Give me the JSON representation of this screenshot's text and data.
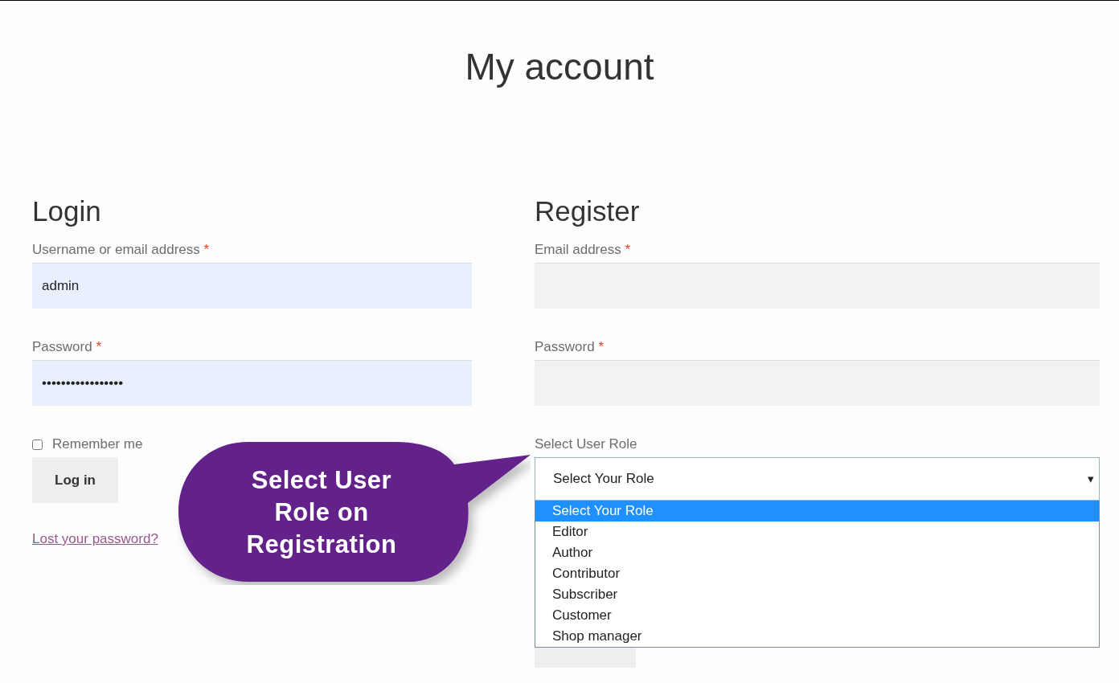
{
  "page_title": "My account",
  "login": {
    "heading": "Login",
    "fields": [
      {
        "label": "Username or email address",
        "required": "*",
        "value": "admin"
      },
      {
        "label": "Password",
        "required": "*",
        "value": "•••••••••••••••••"
      }
    ],
    "remember": {
      "label": "Remember me",
      "checked": false
    },
    "button": "Log in",
    "lost_password": "Lost your password?"
  },
  "register": {
    "heading": "Register",
    "fields": [
      {
        "label": "Email address",
        "required": "*"
      },
      {
        "label": "Password",
        "required": "*"
      }
    ],
    "role": {
      "label": "Select User Role",
      "value": "Select Your Role",
      "caret": "▾",
      "options": [
        {
          "label": "Select Your Role",
          "selected": true
        },
        {
          "label": "Editor",
          "selected": false
        },
        {
          "label": "Author",
          "selected": false
        },
        {
          "label": "Contributor",
          "selected": false
        },
        {
          "label": "Subscriber",
          "selected": false
        },
        {
          "label": "Customer",
          "selected": false
        },
        {
          "label": "Shop manager",
          "selected": false
        }
      ]
    }
  },
  "callout": "Select User Role on Registration"
}
